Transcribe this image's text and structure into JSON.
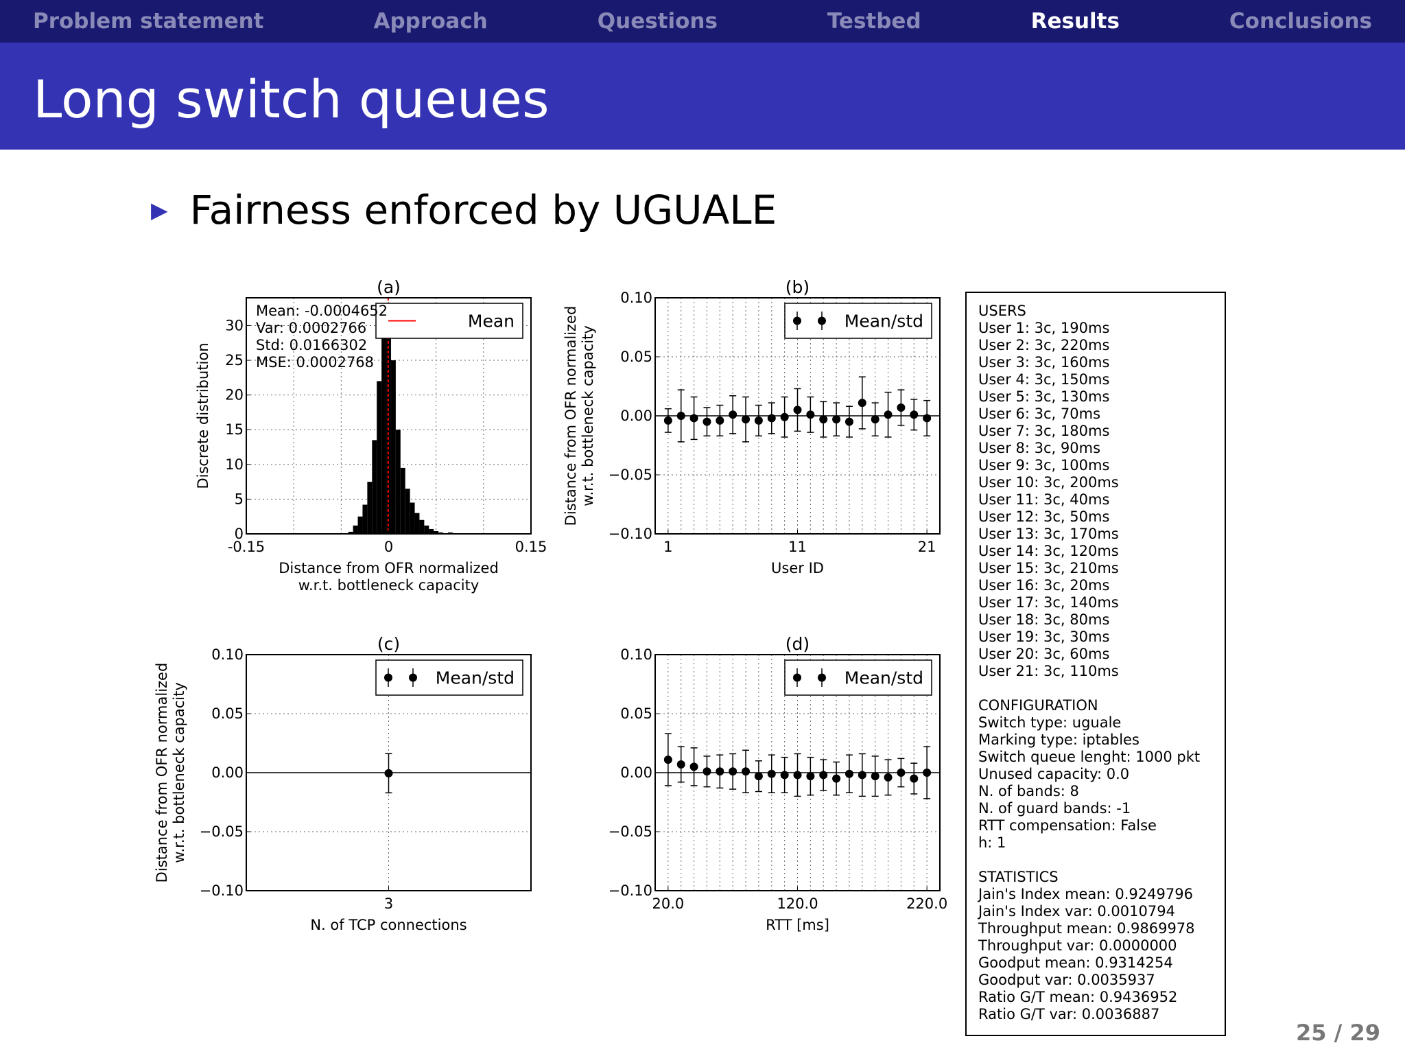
{
  "nav": {
    "items": [
      {
        "label": "Problem statement",
        "active": false
      },
      {
        "label": "Approach",
        "active": false
      },
      {
        "label": "Questions",
        "active": false
      },
      {
        "label": "Testbed",
        "active": false
      },
      {
        "label": "Results",
        "active": true
      },
      {
        "label": "Conclusions",
        "active": false
      }
    ]
  },
  "slide": {
    "title": "Long switch queues",
    "bullet": "Fairness enforced by UGUALE",
    "page": "25 / 29",
    "colors": {
      "nav_bg": "#191970",
      "title_bg": "#3333b3",
      "nav_active": "#ffffff",
      "nav_inactive": "#8a8ab8"
    }
  },
  "chart_data": [
    {
      "type": "bar",
      "title": "(a)",
      "xlabel": [
        "Distance from OFR normalized",
        "w.r.t. bottleneck capacity"
      ],
      "ylabel": "Discrete distribution",
      "xlim": [
        -0.15,
        0.15
      ],
      "ylim": [
        0,
        34
      ],
      "xticks": [
        -0.15,
        0,
        0.15
      ],
      "xtick_labels": [
        "-0.15",
        "0",
        "0.15"
      ],
      "yticks": [
        0,
        5,
        10,
        15,
        20,
        25,
        30
      ],
      "ytick_labels": [
        "0",
        "5",
        "10",
        "15",
        "20",
        "25",
        "30"
      ],
      "grid": true,
      "legend": {
        "placement": "top-right",
        "entries": [
          "Mean"
        ]
      },
      "mean_line": {
        "x": -0.000465,
        "color": "#ff0000"
      },
      "stats_text": [
        "Mean: -0.0004652",
        "Var: 0.0002766",
        "Std: 0.0166302",
        "MSE: 0.0002768"
      ],
      "bin_width": 0.005,
      "bins": [
        {
          "x": -0.04,
          "v": 0.3
        },
        {
          "x": -0.035,
          "v": 1.2
        },
        {
          "x": -0.03,
          "v": 2.5
        },
        {
          "x": -0.025,
          "v": 4.2
        },
        {
          "x": -0.02,
          "v": 7.5
        },
        {
          "x": -0.015,
          "v": 13.5
        },
        {
          "x": -0.01,
          "v": 22.0
        },
        {
          "x": -0.005,
          "v": 30.5
        },
        {
          "x": 0.0,
          "v": 31.5
        },
        {
          "x": 0.005,
          "v": 25.0
        },
        {
          "x": 0.01,
          "v": 15.0
        },
        {
          "x": 0.015,
          "v": 9.5
        },
        {
          "x": 0.02,
          "v": 6.5
        },
        {
          "x": 0.025,
          "v": 4.5
        },
        {
          "x": 0.03,
          "v": 3.0
        },
        {
          "x": 0.035,
          "v": 2.0
        },
        {
          "x": 0.04,
          "v": 1.2
        },
        {
          "x": 0.045,
          "v": 0.7
        },
        {
          "x": 0.05,
          "v": 0.4
        },
        {
          "x": 0.055,
          "v": 0.2
        },
        {
          "x": 0.065,
          "v": 0.2
        },
        {
          "x": 0.075,
          "v": 0.1
        }
      ]
    },
    {
      "type": "scatter",
      "title": "(b)",
      "xlabel": "User ID",
      "ylabel": [
        "Distance from OFR normalized",
        "w.r.t. bottleneck capacity"
      ],
      "xlim": [
        0,
        22
      ],
      "ylim": [
        -0.1,
        0.1
      ],
      "xticks": [
        1,
        11,
        21
      ],
      "xtick_labels": [
        "1",
        "11",
        "21"
      ],
      "yticks": [
        0.1,
        0.05,
        0.0,
        -0.05,
        -0.1
      ],
      "ytick_labels": [
        "0.10",
        "0.05",
        "0.00",
        "−0.05",
        "−0.10"
      ],
      "grid": true,
      "legend": {
        "placement": "top-right",
        "entries": [
          "Mean/std"
        ]
      },
      "x": [
        1,
        2,
        3,
        4,
        5,
        6,
        7,
        8,
        9,
        10,
        11,
        12,
        13,
        14,
        15,
        16,
        17,
        18,
        19,
        20,
        21
      ],
      "mean": [
        -0.004,
        0.0,
        -0.002,
        -0.005,
        -0.004,
        0.001,
        -0.003,
        -0.004,
        -0.002,
        -0.001,
        0.005,
        0.001,
        -0.003,
        -0.003,
        -0.005,
        0.011,
        -0.003,
        0.001,
        0.007,
        0.001,
        -0.002
      ],
      "std": [
        0.01,
        0.022,
        0.018,
        0.012,
        0.013,
        0.016,
        0.019,
        0.013,
        0.013,
        0.017,
        0.018,
        0.015,
        0.015,
        0.014,
        0.013,
        0.022,
        0.014,
        0.019,
        0.015,
        0.013,
        0.015
      ]
    },
    {
      "type": "scatter",
      "title": "(c)",
      "xlabel": "N. of TCP connections",
      "ylabel": [
        "Distance from OFR normalized",
        "w.r.t. bottleneck capacity"
      ],
      "xlim": [
        2,
        4
      ],
      "ylim": [
        -0.1,
        0.1
      ],
      "xticks": [
        3
      ],
      "xtick_labels": [
        "3"
      ],
      "yticks": [
        0.1,
        0.05,
        0.0,
        -0.05,
        -0.1
      ],
      "ytick_labels": [
        "0.10",
        "0.05",
        "0.00",
        "−0.05",
        "−0.10"
      ],
      "grid": true,
      "legend": {
        "placement": "top-right",
        "entries": [
          "Mean/std"
        ]
      },
      "x": [
        3
      ],
      "mean": [
        -0.0005
      ],
      "std": [
        0.0166
      ]
    },
    {
      "type": "scatter",
      "title": "(d)",
      "xlabel": "RTT [ms]",
      "ylabel": "",
      "xlim": [
        10,
        230
      ],
      "ylim": [
        -0.1,
        0.1
      ],
      "xticks": [
        20,
        120,
        220
      ],
      "xtick_labels": [
        "20.0",
        "120.0",
        "220.0"
      ],
      "yticks": [
        0.1,
        0.05,
        0.0,
        -0.05,
        -0.1
      ],
      "ytick_labels": [
        "0.10",
        "0.05",
        "0.00",
        "−0.05",
        "−0.10"
      ],
      "grid": true,
      "legend": {
        "placement": "top-right",
        "entries": [
          "Mean/std"
        ]
      },
      "x": [
        20,
        30,
        40,
        50,
        60,
        70,
        80,
        90,
        100,
        110,
        120,
        130,
        140,
        150,
        160,
        170,
        180,
        190,
        200,
        210,
        220
      ],
      "mean": [
        0.011,
        0.007,
        0.005,
        0.001,
        0.001,
        0.001,
        0.001,
        -0.003,
        -0.001,
        -0.002,
        -0.002,
        -0.003,
        -0.002,
        -0.005,
        -0.001,
        -0.002,
        -0.003,
        -0.004,
        0.0,
        -0.005,
        0.0
      ],
      "std": [
        0.022,
        0.015,
        0.016,
        0.013,
        0.014,
        0.015,
        0.018,
        0.013,
        0.016,
        0.015,
        0.018,
        0.016,
        0.013,
        0.014,
        0.016,
        0.018,
        0.017,
        0.015,
        0.012,
        0.013,
        0.022
      ]
    }
  ],
  "info": {
    "sections": [
      {
        "heading": "USERS",
        "lines": [
          "User 1: 3c, 190ms",
          "User 2: 3c, 220ms",
          "User 3: 3c, 160ms",
          "User 4: 3c, 150ms",
          "User 5: 3c, 130ms",
          "User 6: 3c, 70ms",
          "User 7: 3c, 180ms",
          "User 8: 3c, 90ms",
          "User 9: 3c, 100ms",
          "User 10: 3c, 200ms",
          "User 11: 3c, 40ms",
          "User 12: 3c, 50ms",
          "User 13: 3c, 170ms",
          "User 14: 3c, 120ms",
          "User 15: 3c, 210ms",
          "User 16: 3c, 20ms",
          "User 17: 3c, 140ms",
          "User 18: 3c, 80ms",
          "User 19: 3c, 30ms",
          "User 20: 3c, 60ms",
          "User 21: 3c, 110ms"
        ]
      },
      {
        "heading": "CONFIGURATION",
        "lines": [
          "Switch type: uguale",
          "Marking type: iptables",
          "Switch queue lenght: 1000 pkt",
          "Unused capacity: 0.0",
          "N. of bands: 8",
          "N. of guard bands: -1",
          "RTT compensation: False",
          "h: 1"
        ]
      },
      {
        "heading": "STATISTICS",
        "lines": [
          "Jain's Index mean: 0.9249796",
          "Jain's Index var: 0.0010794",
          "Throughput mean: 0.9869978",
          "Throughput var: 0.0000000",
          "Goodput mean: 0.9314254",
          "Goodput var: 0.0035937",
          "Ratio G/T mean: 0.9436952",
          "Ratio G/T var: 0.0036887"
        ]
      }
    ]
  }
}
